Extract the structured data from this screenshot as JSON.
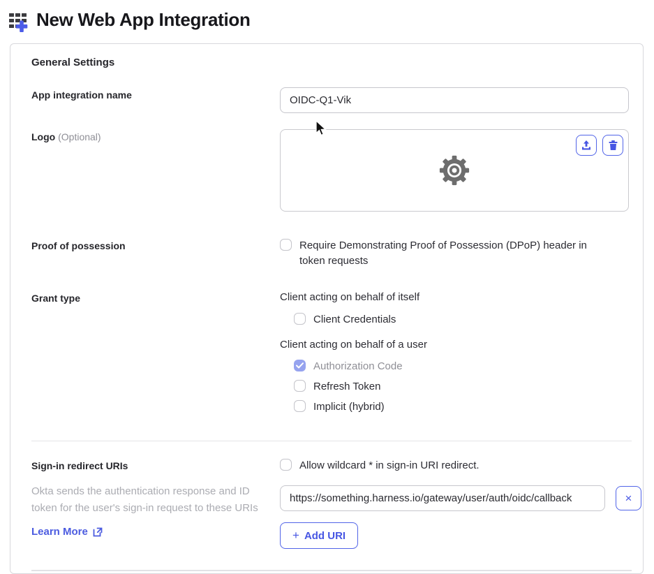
{
  "page": {
    "title": "New Web App Integration"
  },
  "card": {
    "section_title": "General Settings",
    "app_name": {
      "label": "App integration name",
      "value": "OIDC-Q1-Vik"
    },
    "logo": {
      "label": "Logo",
      "optional": "(Optional)",
      "placeholder_icon": "gear-icon",
      "actions": [
        "upload-icon",
        "trash-icon"
      ]
    },
    "proof_of_possession": {
      "label": "Proof of possession",
      "checkbox_label": "Require Demonstrating Proof of Possession (DPoP) header in token requests",
      "checked": false
    },
    "grant_type": {
      "label": "Grant type",
      "group_itself": {
        "title": "Client acting on behalf of itself",
        "options": [
          {
            "label": "Client Credentials",
            "checked": false
          }
        ]
      },
      "group_user": {
        "title": "Client acting on behalf of a user",
        "options": [
          {
            "label": "Authorization Code",
            "checked": true,
            "disabled": true
          },
          {
            "label": "Refresh Token",
            "checked": false
          },
          {
            "label": "Implicit (hybrid)",
            "checked": false
          }
        ]
      }
    },
    "signin_redirect": {
      "label": "Sign-in redirect URIs",
      "help_text": "Okta sends the authentication response and ID token for the user's sign-in request to these URIs",
      "learn_more_label": "Learn More",
      "wildcard_checkbox_label": "Allow wildcard * in sign-in URI redirect.",
      "wildcard_checked": false,
      "uri_value": "https://something.harness.io/gateway/user/auth/oidc/callback",
      "add_uri_label": "Add URI"
    }
  },
  "icons": {
    "plus": "+",
    "close": "×"
  },
  "colors": {
    "accent_blue": "#4c5ce0",
    "checked_checkbox": "#96a3ef",
    "border_gray": "#c6c6cc",
    "muted_text": "#8f8f96",
    "help_text": "#abacb2"
  }
}
